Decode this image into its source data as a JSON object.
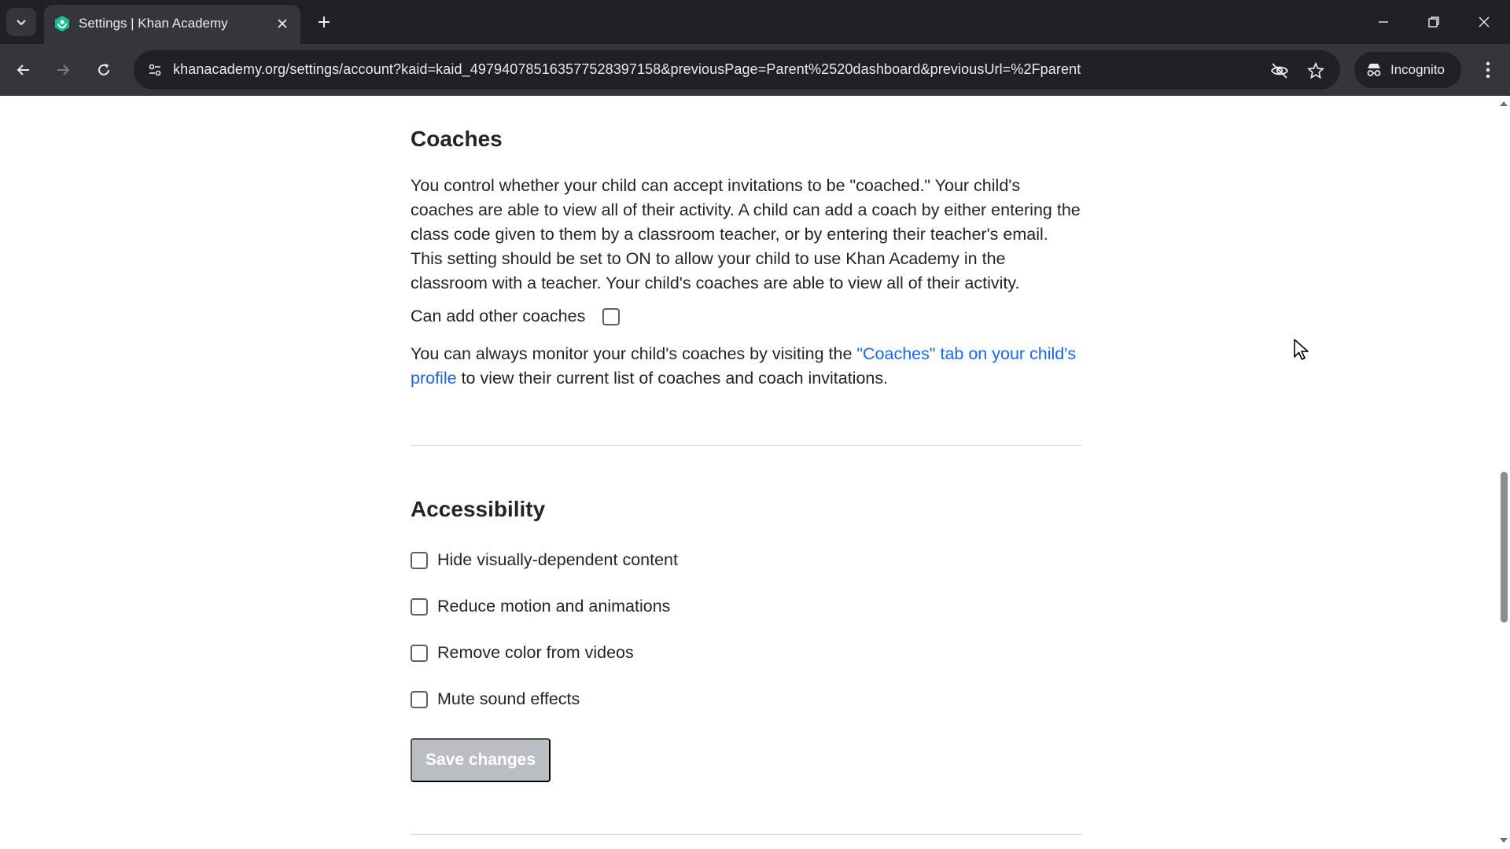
{
  "browser": {
    "tab_title": "Settings | Khan Academy",
    "url": "khanacademy.org/settings/account?kaid=kaid_497940785163577528397158&previousPage=Parent%2520dashboard&previousUrl=%2Fparent",
    "incognito_label": "Incognito"
  },
  "coaches": {
    "title": "Coaches",
    "description": "You control whether your child can accept invitations to be \"coached.\" Your child's coaches are able to view all of their activity. A child can add a coach by either entering the class code given to them by a classroom teacher, or by entering their teacher's email. This setting should be set to ON to allow your child to use Khan Academy in the classroom with a teacher. Your child's coaches are able to view all of their activity.",
    "can_add_label": "Can add other coaches",
    "can_add_checked": false,
    "monitor_prefix": "You can always monitor your child's coaches by visiting the ",
    "monitor_link": "\"Coaches\" tab on your child's profile",
    "monitor_suffix": " to view their current list of coaches and coach invitations."
  },
  "accessibility": {
    "title": "Accessibility",
    "options": [
      {
        "label": "Hide visually-dependent content",
        "checked": false
      },
      {
        "label": "Reduce motion and animations",
        "checked": false
      },
      {
        "label": "Remove color from videos",
        "checked": false
      },
      {
        "label": "Mute sound effects",
        "checked": false
      }
    ],
    "save_label": "Save changes"
  },
  "colors": {
    "link": "#1865f2",
    "brand_green": "#14bf96",
    "save_disabled": "#babec2"
  }
}
